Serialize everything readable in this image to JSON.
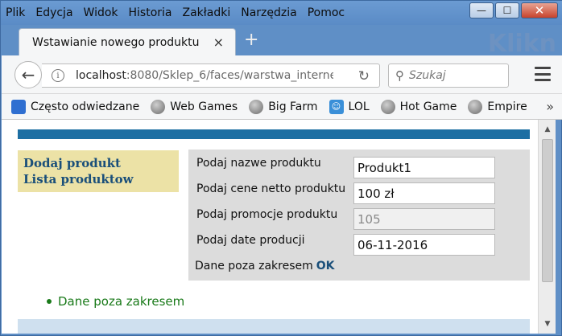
{
  "menu": [
    {
      "label": "Plik"
    },
    {
      "label": "Edycja"
    },
    {
      "label": "Widok"
    },
    {
      "label": "Historia"
    },
    {
      "label": "Zakładki"
    },
    {
      "label": "Narzędzia"
    },
    {
      "label": "Pomoc"
    }
  ],
  "window": {
    "minimize": "—",
    "maximize": "☐",
    "close": "✕"
  },
  "tab": {
    "title": "Wstawianie nowego produktu",
    "close": "×",
    "new_tab": "+"
  },
  "background_text": "Klikn",
  "nav": {
    "url_host": "localhost",
    "url_rest": ":8080/Sklep_6/faces/warstwa_interne",
    "search_placeholder": "Szukaj"
  },
  "bookmarks": [
    {
      "label": "Często odwiedzane",
      "icon": "most-visited-icon"
    },
    {
      "label": "Web Games",
      "icon": "globe-icon"
    },
    {
      "label": "Big Farm",
      "icon": "globe-icon"
    },
    {
      "label": "LOL",
      "icon": "lol-icon"
    },
    {
      "label": "Hot Game",
      "icon": "globe-icon"
    },
    {
      "label": "Empire",
      "icon": "globe-icon"
    }
  ],
  "sidebar": {
    "links": [
      {
        "label": "Dodaj produkt"
      },
      {
        "label": "Lista produktow"
      }
    ]
  },
  "form": {
    "rows": [
      {
        "label": "Podaj nazwe produktu",
        "value": "Produkt1",
        "disabled": false
      },
      {
        "label": "Podaj cene netto produktu",
        "value": "100 zł",
        "disabled": false
      },
      {
        "label": "Podaj promocje produktu",
        "value": "105",
        "disabled": true
      },
      {
        "label": "Podaj date producji",
        "value": "06-11-2016",
        "disabled": false
      }
    ],
    "message": "Dane poza zakresem",
    "ok_label": "OK"
  },
  "messages": [
    "Dane poza zakresem"
  ],
  "colors": {
    "band": "#1d6fa3",
    "sidebar_bg": "#ece2a6",
    "link": "#1a4f7a",
    "panel_bg": "#dcdcdc",
    "message_green": "#1a7a1a"
  }
}
